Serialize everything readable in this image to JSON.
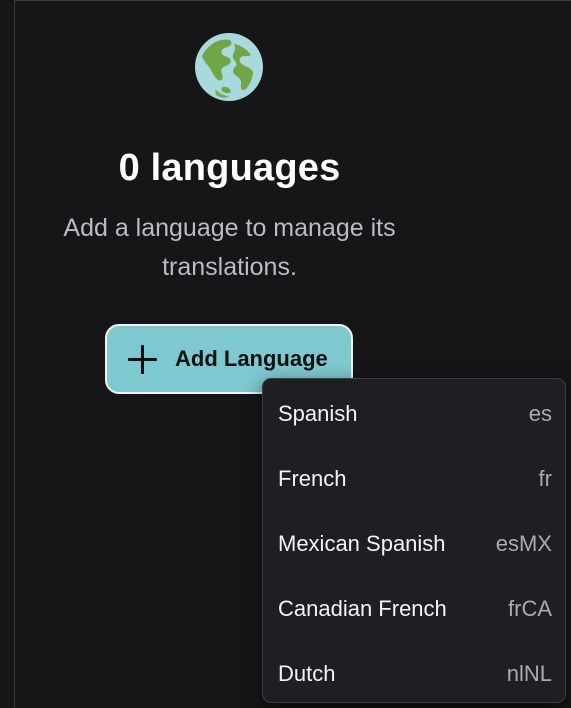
{
  "empty_state": {
    "icon": "globe-americas-icon",
    "title": "0 languages",
    "subtitle": "Add a language to manage its translations.",
    "add_button": {
      "icon": "plus-icon",
      "label": "Add Language"
    }
  },
  "language_menu": {
    "items": [
      {
        "name": "Spanish",
        "code": "es"
      },
      {
        "name": "French",
        "code": "fr"
      },
      {
        "name": "Mexican Spanish",
        "code": "esMX"
      },
      {
        "name": "Canadian French",
        "code": "frCA"
      },
      {
        "name": "Dutch",
        "code": "nlNL"
      }
    ]
  },
  "colors": {
    "background": "#161618",
    "accent": "#7ec8cf",
    "menu_background": "#1f1f23"
  }
}
